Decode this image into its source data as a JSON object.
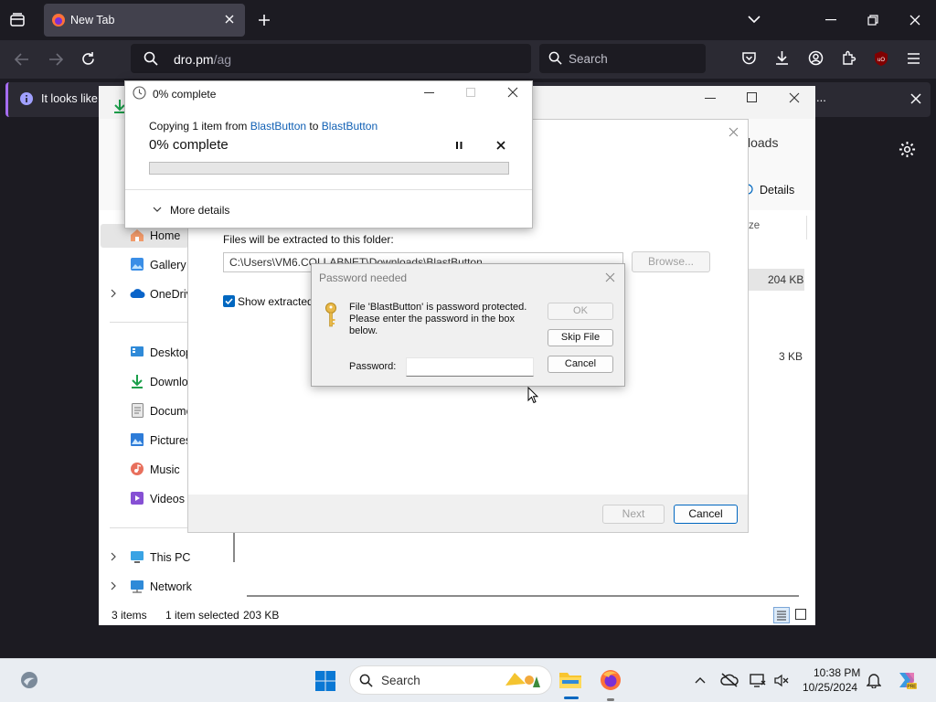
{
  "browser": {
    "tab_title": "New Tab",
    "url_main": "dro.pm",
    "url_path": "/ag",
    "search_placeholder": "Search",
    "notification_text": "It looks like",
    "notification_more": "..."
  },
  "explorer": {
    "downloads_partial": "loads",
    "details_label": "Details",
    "size_header": "ze",
    "file_size_1": "204 KB",
    "file_size_2": "3 KB",
    "sidebar": {
      "home": "Home",
      "gallery": "Gallery",
      "onedrive": "OneDriv",
      "desktop": "Desktop",
      "downloads": "Downlo",
      "documents": "Docume",
      "pictures": "Pictures",
      "music": "Music",
      "videos": "Videos",
      "this_pc": "This PC",
      "network": "Network"
    },
    "status": {
      "items": "3 items",
      "selected": "1 item selected",
      "size": "203 KB"
    }
  },
  "wizard": {
    "extract_to_label": "Files will be extracted to this folder:",
    "path_value": "C:\\Users\\VM6.COLLABNET\\Downloads\\BlastButton",
    "browse_label": "Browse...",
    "show_extracted_label": "Show extracted",
    "next_label": "Next",
    "cancel_label": "Cancel"
  },
  "progress": {
    "window_title": "0% complete",
    "copying_prefix": "Copying 1 item from ",
    "source": "BlastButton",
    "to_word": " to ",
    "destination": "BlastButton",
    "percent_text": "0% complete",
    "progress_fraction": 0,
    "more_details": "More details"
  },
  "password": {
    "title": "Password needed",
    "message_line1": "File 'BlastButton' is password protected.",
    "message_line2": "Please enter the password in the box",
    "message_line3": "below.",
    "password_label": "Password:",
    "password_value": "",
    "ok_label": "OK",
    "skip_label": "Skip File",
    "cancel_label": "Cancel"
  },
  "taskbar": {
    "search_placeholder": "Search",
    "time": "10:38 PM",
    "date": "10/25/2024"
  },
  "colors": {
    "firefox_bg": "#1c1b22",
    "accent_blue": "#0067c0",
    "link_blue": "#0f5fb4",
    "notif_stripe": "#a56cf0"
  }
}
